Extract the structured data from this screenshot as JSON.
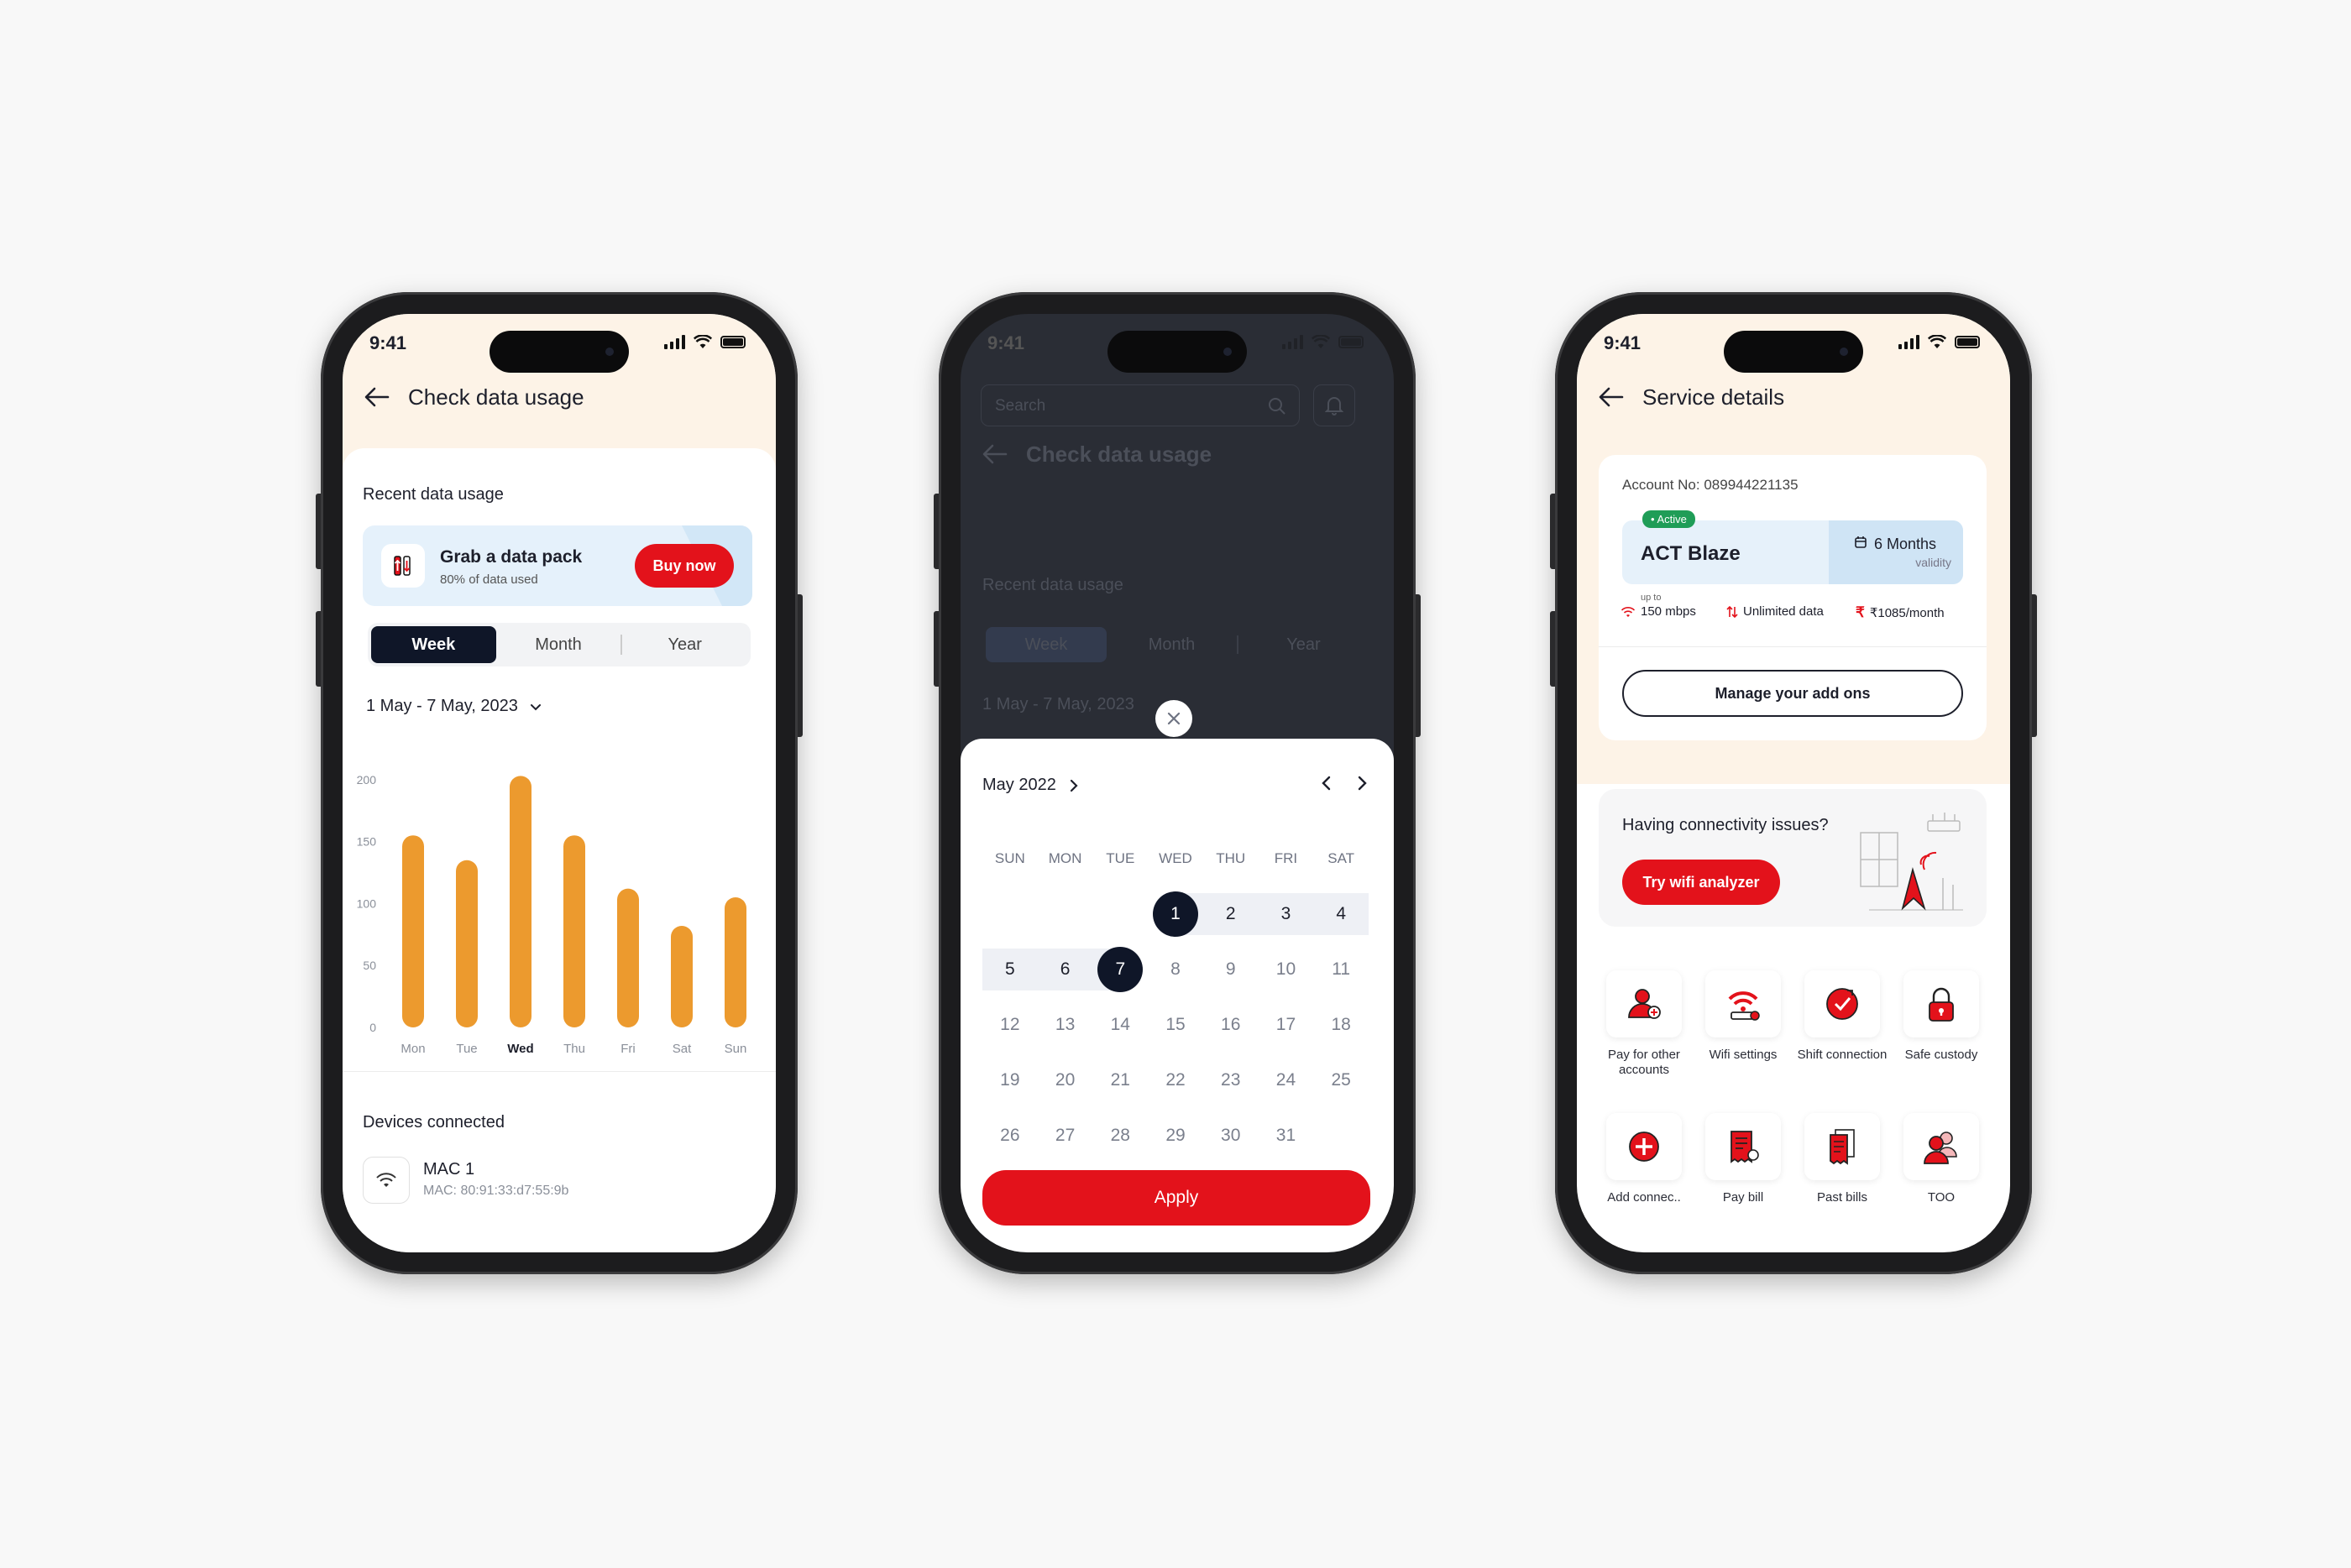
{
  "status": {
    "time": "9:41"
  },
  "phone1": {
    "title": "Check data usage",
    "recent_label": "Recent data usage",
    "promo": {
      "title": "Grab a data pack",
      "subtitle": "80% of data used",
      "button": "Buy now"
    },
    "tabs": [
      "Week",
      "Month",
      "Year"
    ],
    "date_range": "1 May - 7 May, 2023",
    "devices_label": "Devices connected",
    "device": {
      "name": "MAC 1",
      "mac": "MAC: 80:91:33:d7:55:9b"
    }
  },
  "chart_data": {
    "type": "bar",
    "categories": [
      "Mon",
      "Tue",
      "Wed",
      "Thu",
      "Fri",
      "Sat",
      "Sun"
    ],
    "values": [
      155,
      135,
      203,
      155,
      112,
      82,
      105
    ],
    "yticks": [
      0,
      50,
      100,
      150,
      200
    ],
    "ylim": [
      0,
      210
    ],
    "highlight": "Wed",
    "bar_color": "#ec9a2e"
  },
  "phone2": {
    "search_placeholder": "Search",
    "title": "Check data usage",
    "recent_label": "Recent data usage",
    "tabs": [
      "Week",
      "Month",
      "Year"
    ],
    "date_range": "1 May - 7 May, 2023",
    "month_label": "May 2022",
    "dow": [
      "SUN",
      "MON",
      "TUE",
      "WED",
      "THU",
      "FRI",
      "SAT"
    ],
    "weeks": [
      [
        "",
        "",
        "",
        "1",
        "2",
        "3",
        "4"
      ],
      [
        "5",
        "6",
        "7",
        "8",
        "9",
        "10",
        "11"
      ],
      [
        "12",
        "13",
        "14",
        "15",
        "16",
        "17",
        "18"
      ],
      [
        "19",
        "20",
        "21",
        "22",
        "23",
        "24",
        "25"
      ],
      [
        "26",
        "27",
        "28",
        "29",
        "30",
        "31",
        ""
      ]
    ],
    "range_start": "1",
    "range_end": "7",
    "apply": "Apply"
  },
  "phone3": {
    "title": "Service details",
    "account": "Account No: 089944221135",
    "status_badge": "• Active",
    "plan_name": "ACT Blaze",
    "validity": "6 Months",
    "validity_sub": "validity",
    "speed_prefix": "up to",
    "speed": "150 mbps",
    "data": "Unlimited data",
    "price": "₹1085/month",
    "manage": "Manage your add ons",
    "issue_title": "Having connectivity issues?",
    "issue_button": "Try wifi analyzer",
    "tiles": [
      {
        "label": "Pay for other accounts",
        "icon": "user-plus-icon"
      },
      {
        "label": "Wifi settings",
        "icon": "wifi-router-icon"
      },
      {
        "label": "Shift connection",
        "icon": "shift-icon"
      },
      {
        "label": "Safe custody",
        "icon": "lock-icon"
      },
      {
        "label": "Add connec..",
        "icon": "add-circle-icon"
      },
      {
        "label": "Pay bill",
        "icon": "bill-icon"
      },
      {
        "label": "Past bills",
        "icon": "past-bills-icon"
      },
      {
        "label": "TOO",
        "icon": "users-icon"
      }
    ],
    "accent": "#e3121b"
  }
}
